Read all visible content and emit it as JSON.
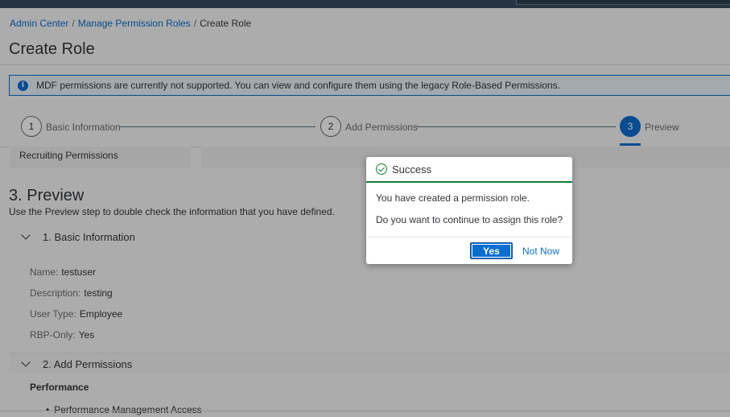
{
  "breadcrumb": {
    "items": [
      "Admin Center",
      "Manage Permission Roles"
    ],
    "current": "Create Role",
    "separator": "/"
  },
  "page_title": "Create Role",
  "info_message": {
    "icon": "info-icon",
    "text": "MDF permissions are currently not supported. You can view and configure them using the legacy Role-Based Permissions."
  },
  "wizard": {
    "steps": [
      {
        "number": "1",
        "label": "Basic Information"
      },
      {
        "number": "2",
        "label": "Add Permissions"
      },
      {
        "number": "3",
        "label": "Preview",
        "active": true
      }
    ]
  },
  "tab": {
    "label": "Recruiting Permissions"
  },
  "preview": {
    "title": "3. Preview",
    "description": "Use the Preview step to double check the information that you have defined."
  },
  "basic_info_panel": {
    "title": "1. Basic Information",
    "fields": [
      {
        "label": "Name:",
        "value": "testuser"
      },
      {
        "label": "Description:",
        "value": "testing"
      },
      {
        "label": "User Type:",
        "value": "Employee"
      },
      {
        "label": "RBP-Only:",
        "value": "Yes"
      }
    ]
  },
  "permissions_panel": {
    "title": "2. Add Permissions",
    "group": "Performance",
    "items": [
      "Performance Management Access"
    ]
  },
  "dialog": {
    "title": "Success",
    "message1": "You have created a permission role.",
    "message2": "Do you want to continue to assign this role?",
    "yes_label": "Yes",
    "not_now_label": "Not Now"
  },
  "colors": {
    "accent": "#0a6ed1",
    "success": "#107e3e",
    "shell": "#354a5f"
  }
}
